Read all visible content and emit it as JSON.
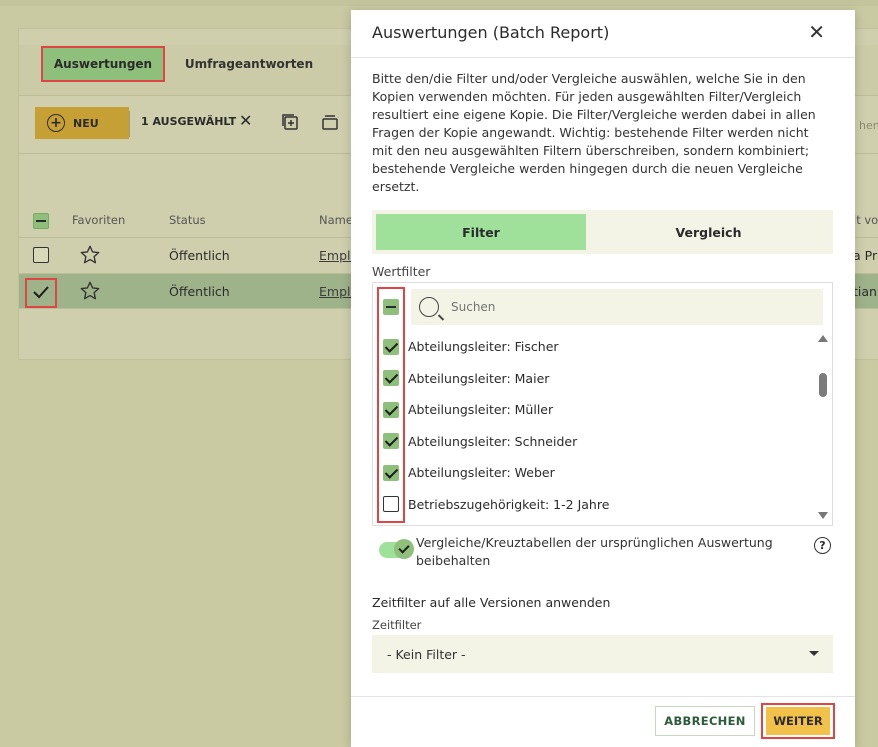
{
  "background": {
    "tabs": [
      {
        "label": "Auswertungen",
        "active": true
      },
      {
        "label": "Umfrageantworten",
        "active": false
      }
    ],
    "toolbar": {
      "new_label": "NEU",
      "selected_count_label": "1 AUSGEWÄHLT",
      "search_stub": "hen"
    },
    "table": {
      "headers": {
        "favorites": "Favoriten",
        "status": "Status",
        "name": "Name",
        "right": "lt vo"
      },
      "rows": [
        {
          "status": "Öffentlich",
          "name": "Emplo",
          "right": "a Pra",
          "selected": false
        },
        {
          "status": "Öffentlich",
          "name": "Emplo",
          "right": "tian",
          "selected": true
        }
      ]
    }
  },
  "modal": {
    "title": "Auswertungen (Batch Report)",
    "description": "Bitte den/die Filter und/oder Vergleiche auswählen, welche Sie in den Kopien verwenden möchten. Für jeden ausgewählten Filter/Vergleich resultiert eine eigene Kopie. Die Filter/Vergleiche werden dabei in allen Fragen der Kopie angewandt. Wichtig: bestehende Filter werden nicht mit den neu ausgewählten Filtern überschreiben, sondern kombiniert; bestehende Vergleiche werden hingegen durch die neuen Vergleiche ersetzt.",
    "segments": {
      "filter": "Filter",
      "compare": "Vergleich"
    },
    "value_filter_label": "Wertfilter",
    "search_placeholder": "Suchen",
    "items": [
      {
        "label": "Abteilungsleiter: Fischer",
        "checked": true
      },
      {
        "label": "Abteilungsleiter: Maier",
        "checked": true
      },
      {
        "label": "Abteilungsleiter: Müller",
        "checked": true
      },
      {
        "label": "Abteilungsleiter: Schneider",
        "checked": true
      },
      {
        "label": "Abteilungsleiter: Weber",
        "checked": true
      },
      {
        "label": "Betriebszugehörigkeit: 1-2 Jahre",
        "checked": false
      }
    ],
    "toggle_label": "Vergleiche/Kreuztabellen der ursprünglichen Auswertung beibehalten",
    "help_glyph": "?",
    "time_section_title": "Zeitfilter auf alle Versionen anwenden",
    "time_filter_label": "Zeitfilter",
    "time_filter_value": "- Kein Filter -",
    "cancel_label": "ABBRECHEN",
    "next_label": "WEITER"
  },
  "colors": {
    "accent_green": "#9fe09a",
    "highlight_red": "#e04545",
    "primary_yellow": "#f2c14a"
  }
}
